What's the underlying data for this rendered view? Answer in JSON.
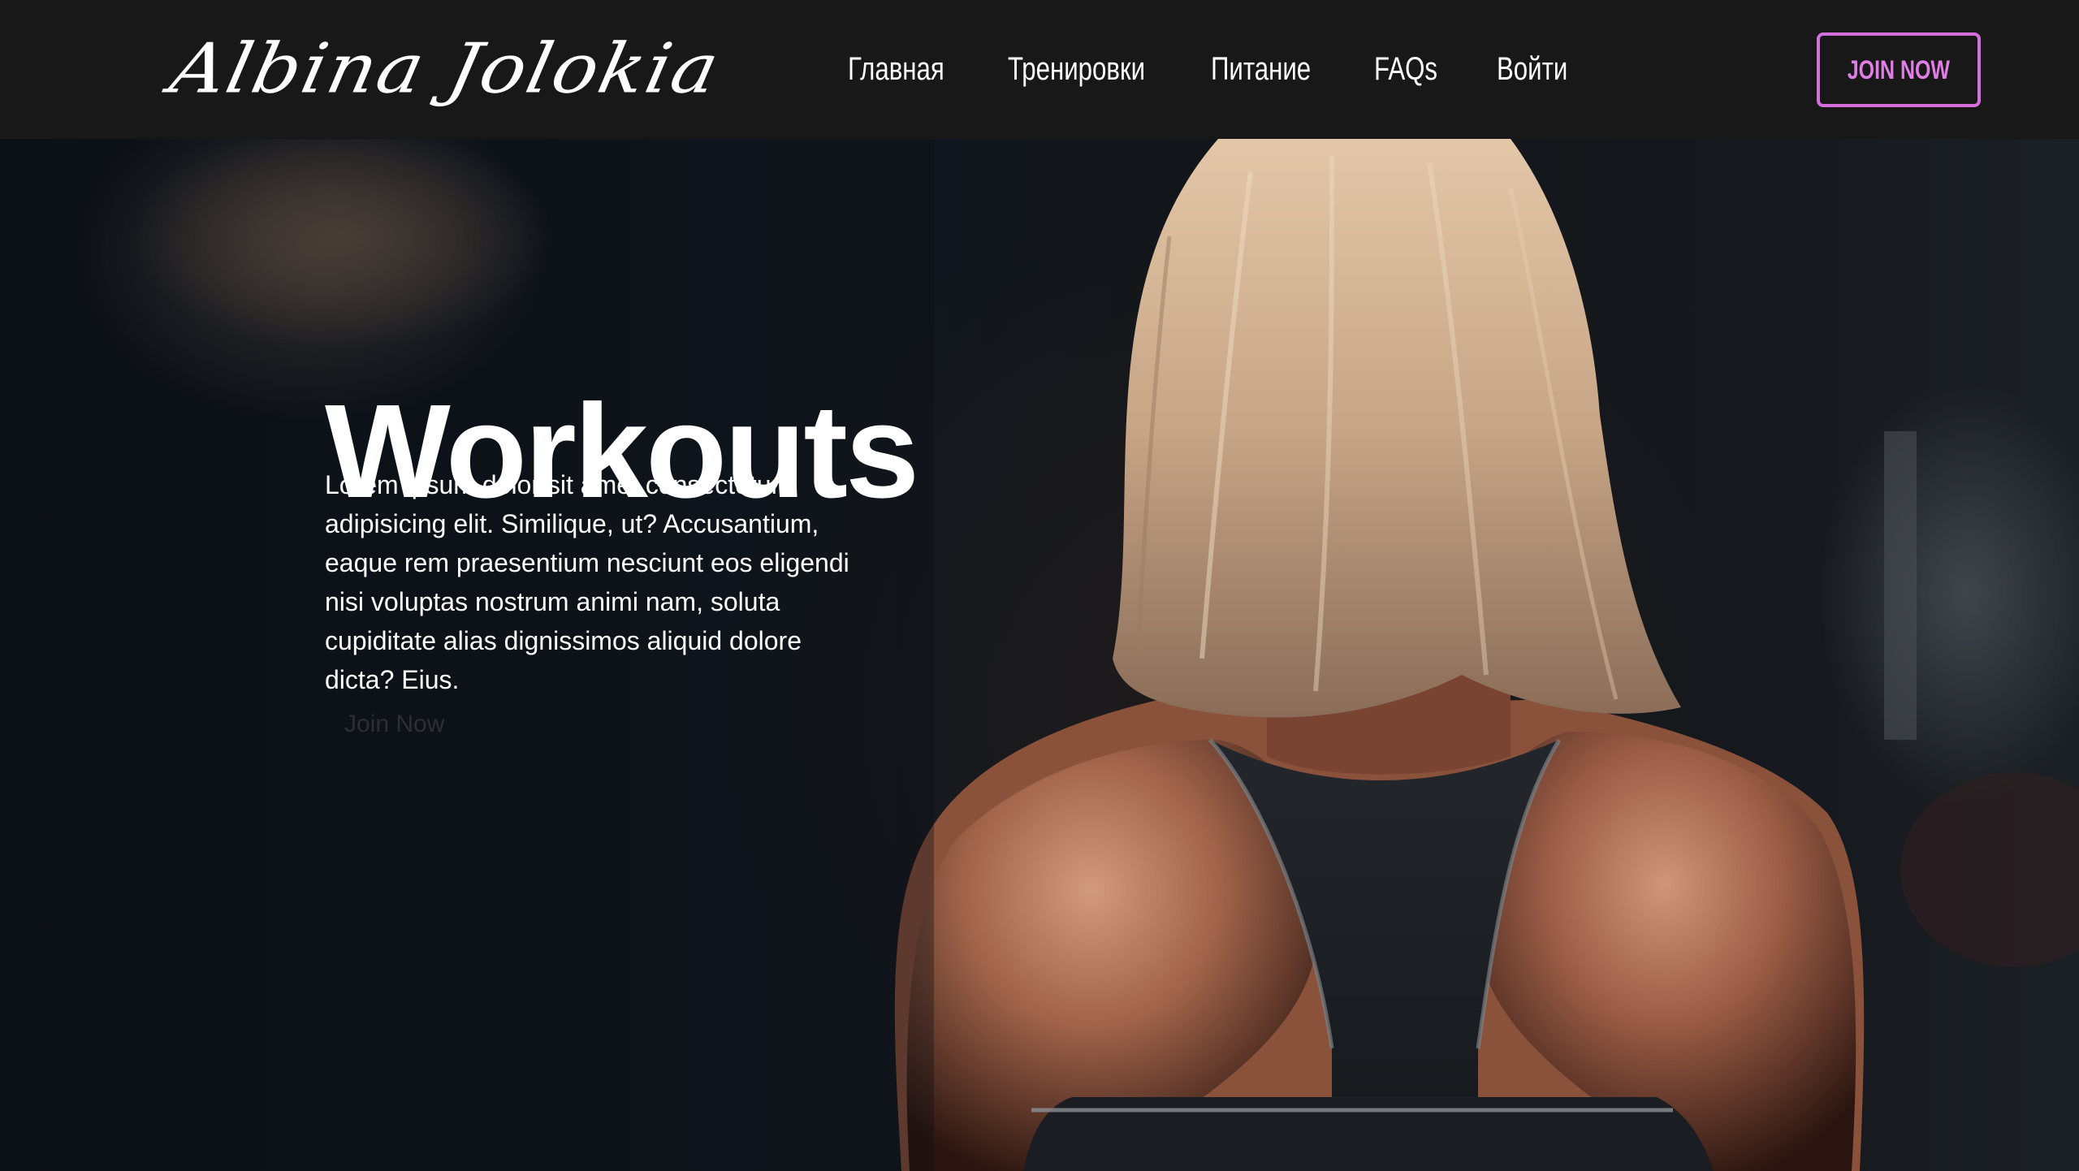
{
  "header": {
    "logo": "Albina Jolokia",
    "nav": [
      "Главная",
      "Тренировки",
      "Питание",
      "FAQs",
      "Войти"
    ],
    "join_button": "JOIN NOW"
  },
  "hero": {
    "title": "Workouts",
    "text": "Lorem ipsum dolor sit amet consectetur adipisicing elit. Similique, ut? Accusantium, eaque rem praesentium nesciunt eos eligendi nisi voluptas nostrum animi nam, soluta cupiditate alias dignissimos aliquid dolore dicta? Eius.",
    "join_button": "Join Now"
  },
  "colors": {
    "header_bg": "#181818",
    "accent": "#e07ee6",
    "hero_text": "#ffffff"
  }
}
